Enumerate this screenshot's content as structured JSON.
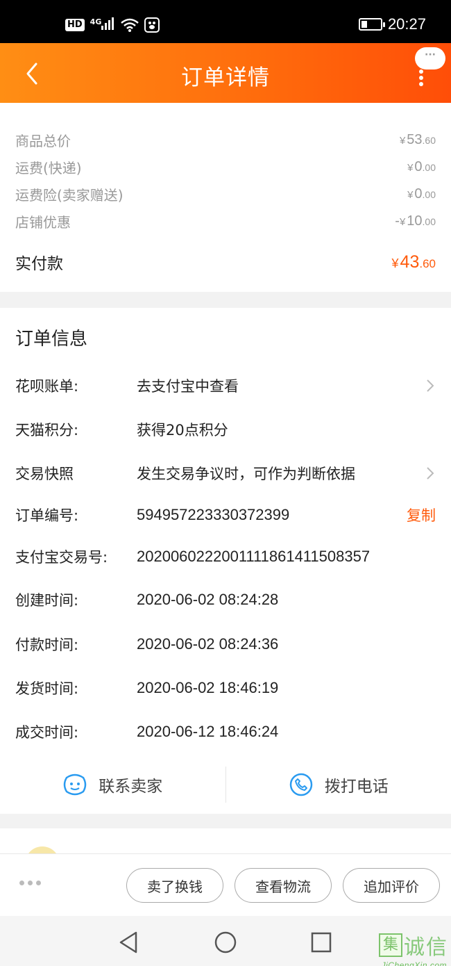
{
  "status_bar": {
    "hd": "HD",
    "network": "4G",
    "time": "20:27"
  },
  "header": {
    "title": "订单详情",
    "bubble": "···"
  },
  "price_summary": {
    "rows": [
      {
        "label": "商品总价",
        "prefix": "",
        "currency": "¥",
        "integer": "53",
        "decimal": ".60"
      },
      {
        "label": "运费(快递)",
        "prefix": "",
        "currency": "¥",
        "integer": "0",
        "decimal": ".00"
      },
      {
        "label": "运费险(卖家赠送)",
        "prefix": "",
        "currency": "¥",
        "integer": "0",
        "decimal": ".00"
      },
      {
        "label": "店铺优惠",
        "prefix": "-",
        "currency": "¥",
        "integer": "10",
        "decimal": ".00"
      }
    ],
    "total": {
      "label": "实付款",
      "currency": "¥",
      "integer": "43",
      "decimal": ".60"
    }
  },
  "order_info": {
    "title": "订单信息",
    "rows": [
      {
        "label": "花呗账单:",
        "value": "去支付宝中查看"
      },
      {
        "label": "天猫积分:",
        "value": "获得20点积分"
      },
      {
        "label": "交易快照",
        "value": "发生交易争议时，可作为判断依据"
      },
      {
        "label": "订单编号:",
        "value": "594957223330372399",
        "action": "复制"
      },
      {
        "label": "支付宝交易号:",
        "value": "2020060222001111861411508357"
      },
      {
        "label": "创建时间:",
        "value": "2020-06-02 08:24:28"
      },
      {
        "label": "付款时间:",
        "value": "2020-06-02 08:24:36"
      },
      {
        "label": "发货时间:",
        "value": "2020-06-02 18:46:19"
      },
      {
        "label": "成交时间:",
        "value": "2020-06-12 18:46:24"
      }
    ],
    "contact_seller": "联系卖家",
    "call_phone": "拨打电话"
  },
  "actions": {
    "sell": "卖了换钱",
    "logistics": "查看物流",
    "review": "追加评价"
  },
  "icons": {
    "back": "chevron-left-icon",
    "more": "more-vertical-icon",
    "chat": "smiley-chat-icon",
    "phone": "phone-icon",
    "nav_back": "triangle-back-icon",
    "nav_home": "circle-home-icon",
    "nav_recents": "square-recents-icon"
  },
  "colors": {
    "accent": "#ff5b0c",
    "header_start": "#ff8e14",
    "header_end": "#ff4e08",
    "icon_blue": "#2a9bf0"
  },
  "watermark": {
    "box_char": "集",
    "char_1": "诚",
    "char_2": "信",
    "domain": "JiChengXin.com"
  }
}
